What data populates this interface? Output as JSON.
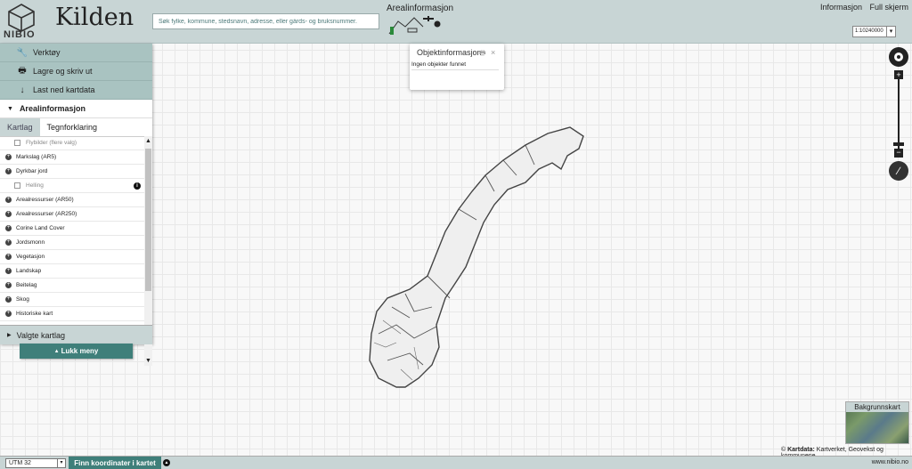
{
  "header": {
    "logo_text": "NIBIO",
    "app_title": "Kilden",
    "search_placeholder": "Søk fylke, kommune, stedsnavn, adresse, eller gårds- og bruksnummer.",
    "areal_label": "Arealinformasjon",
    "links": [
      "Informasjon",
      "Full skjerm"
    ],
    "scale": "1:10240000"
  },
  "sidebar": {
    "tools": [
      {
        "label": "Verktøy",
        "icon": "wrench-icon"
      },
      {
        "label": "Lagre og skriv ut",
        "icon": "printer-icon"
      },
      {
        "label": "Last ned kartdata",
        "icon": "download-icon"
      }
    ],
    "section_title": "Arealinformasjon",
    "tabs": [
      "Kartlag",
      "Tegnforklaring"
    ],
    "active_tab": "Kartlag",
    "layers": [
      {
        "label": "Flybilder (flere valg)",
        "kind": "checkbox",
        "dim": true
      },
      {
        "label": "Markslag (AR5)",
        "kind": "group"
      },
      {
        "label": "Dyrkbar jord",
        "kind": "group"
      },
      {
        "label": "Helling",
        "kind": "checkbox",
        "dim": true,
        "info": true
      },
      {
        "label": "Arealressurser (AR50)",
        "kind": "group"
      },
      {
        "label": "Arealressurser (AR250)",
        "kind": "group"
      },
      {
        "label": "Corine Land Cover",
        "kind": "group"
      },
      {
        "label": "Jordsmonn",
        "kind": "group"
      },
      {
        "label": "Vegetasjon",
        "kind": "group"
      },
      {
        "label": "Landskap",
        "kind": "group"
      },
      {
        "label": "Beitelag",
        "kind": "group"
      },
      {
        "label": "Skog",
        "kind": "group"
      },
      {
        "label": "Historiske kart",
        "kind": "group"
      }
    ],
    "selected_layers": "Valgte kartlag",
    "close_menu": "Lukk meny"
  },
  "popup": {
    "title": "Objektinformasjon",
    "body": "Ingen objekter funnet"
  },
  "map": {
    "background_map_label": "Bakgrunnskart",
    "attribution_prefix": "© ",
    "attribution_bold": "Kartdata:",
    "attribution_rest": " Kartverket, Geovekst og kommunene"
  },
  "footer": {
    "projection": "UTM 32",
    "find_coordinates": "Finn koordinater i kartet",
    "url": "www.nibio.no"
  },
  "colors": {
    "header_bg": "#c8d5d5",
    "tool_bg": "#a9c3c1",
    "accent": "#3f7f7a"
  }
}
